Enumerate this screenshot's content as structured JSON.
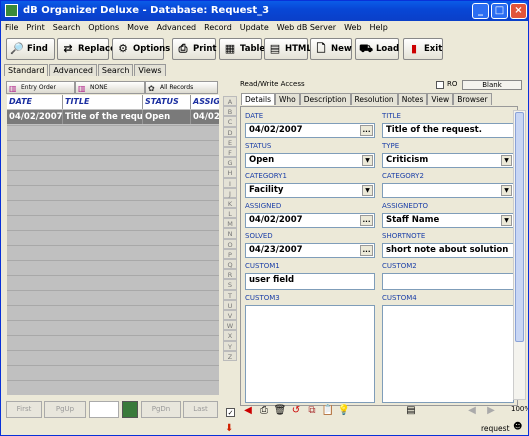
{
  "title": "dB Organizer Deluxe - Database: Request_3",
  "window_buttons": [
    "_",
    "□",
    "×"
  ],
  "menu": [
    "File",
    "Print",
    "Search",
    "Options",
    "Move",
    "Advanced",
    "Record",
    "Update",
    "Web dB Server",
    "Web",
    "Help"
  ],
  "toolbar": {
    "find": "Find",
    "replace": "Replace",
    "options": "Options",
    "print": "Print",
    "table": "Table",
    "html": "HTML",
    "new": "New",
    "load": "Load",
    "exit": "Exit"
  },
  "left_tabs": [
    "Standard",
    "Advanced",
    "Search",
    "Views"
  ],
  "list_buttons": {
    "entry_order": "Entry Order",
    "none": "NONE",
    "all_records": "All Records"
  },
  "grid": {
    "headers": [
      "DATE",
      "TITLE",
      "STATUS",
      "ASSIG"
    ],
    "rows": [
      [
        "04/02/2007",
        "Title of the request.",
        "Open",
        "04/02"
      ]
    ]
  },
  "pager": {
    "first": "First",
    "pgup": "PgUp",
    "page": "",
    "pgdn": "PgDn",
    "last": "Last"
  },
  "alpha": [
    "A",
    "B",
    "C",
    "D",
    "E",
    "F",
    "G",
    "H",
    "I",
    "J",
    "K",
    "L",
    "M",
    "N",
    "O",
    "P",
    "Q",
    "R",
    "S",
    "T",
    "U",
    "V",
    "W",
    "X",
    "Y",
    "Z"
  ],
  "right": {
    "access": "Read/Write Access",
    "ro_label": "RO",
    "blank_button": "Blank",
    "tabs": [
      "Details",
      "Who",
      "Description",
      "Resolution",
      "Notes",
      "View",
      "Browser"
    ]
  },
  "form": {
    "date": {
      "label": "DATE",
      "value": "04/02/2007"
    },
    "title": {
      "label": "TITLE",
      "value": "Title of the request."
    },
    "status": {
      "label": "STATUS",
      "value": "Open"
    },
    "type": {
      "label": "TYPE",
      "value": "Criticism"
    },
    "category1": {
      "label": "CATEGORY1",
      "value": "Facility"
    },
    "category2": {
      "label": "CATEGORY2",
      "value": ""
    },
    "assigned": {
      "label": "ASSIGNED",
      "value": "04/02/2007"
    },
    "assignedto": {
      "label": "ASSIGNEDTO",
      "value": "Staff Name"
    },
    "solved": {
      "label": "SOLVED",
      "value": "04/23/2007"
    },
    "shortnote": {
      "label": "SHORTNOTE",
      "value": "short note about solution"
    },
    "custom1": {
      "label": "CUSTOM1",
      "value": "user field"
    },
    "custom2": {
      "label": "CUSTOM2",
      "value": ""
    },
    "custom3": {
      "label": "CUSTOM3",
      "value": ""
    },
    "custom4": {
      "label": "CUSTOM4",
      "value": ""
    }
  },
  "status": {
    "zoom": "100%",
    "table": "request"
  }
}
